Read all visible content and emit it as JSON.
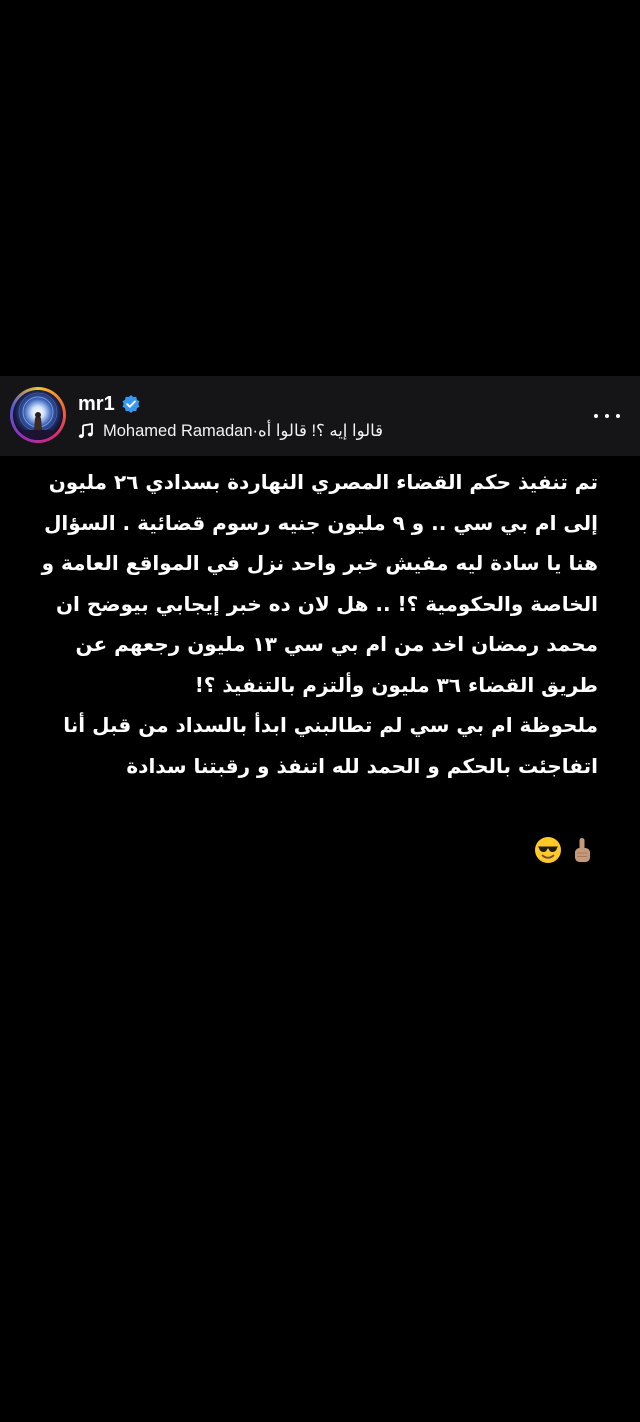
{
  "post_header": {
    "username": "mr1",
    "verified": true,
    "music_artist": "Mohamed Ramadan",
    "music_separator": " · ",
    "music_title": "قالوا إيه ؟! قالوا أه",
    "icons": {
      "avatar": "profile-avatar",
      "verified": "verified-badge-icon",
      "music": "music-note-icon",
      "more": "more-options-icon"
    },
    "colors": {
      "header_bg": "#151517",
      "verified_badge": "#3897f0"
    }
  },
  "post": {
    "paragraph1": "تم تنفيذ حكم القضاء المصري النهاردة بسدادي ٢٦ مليون إلى ام بي سي .. و ٩ مليون جنيه رسوم قضائية . السؤال هنا يا سادة ليه مفيش خبر واحد نزل في المواقع العامة و الخاصة والحكومية ؟! .. هل لان ده خبر إيجابي بيوضح ان محمد رمضان اخد من ام بي سي ١٣ مليون رجعهم عن  طريق القضاء ٣٦ مليون وألتزم بالتنفيذ ؟!",
    "paragraph2": "ملحوظة ام بي سي لم تطالبني ابدأ بالسداد من قبل أنا اتفاجئت بالحكم و الحمد لله اتنفذ و رقبتنا سدادة",
    "emojis": [
      "smiling-face-with-sunglasses-emoji",
      "index-pointing-up-emoji"
    ]
  }
}
